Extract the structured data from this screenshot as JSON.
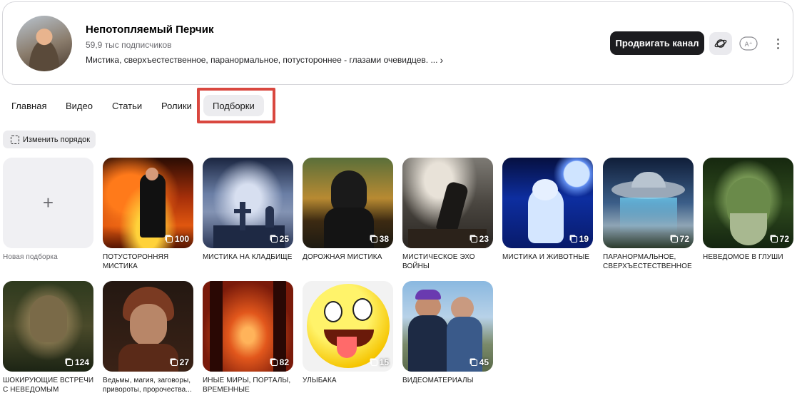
{
  "channel": {
    "title": "Непотопляемый Перчик",
    "subscribers": "59,9 тыс подписчиков",
    "description": "Мистика, сверхъестественное, паранормальное, потустороннее - глазами очевидцев. ...",
    "promote_label": "Продвигать канал",
    "ai_icon_text": "A⁺"
  },
  "tabs": [
    {
      "label": "Главная"
    },
    {
      "label": "Видео"
    },
    {
      "label": "Статьи"
    },
    {
      "label": "Ролики"
    },
    {
      "label": "Подборки"
    }
  ],
  "toolbar": {
    "reorder_label": "Изменить порядок"
  },
  "new_collection": {
    "label": "Новая подборка"
  },
  "collections": [
    {
      "title": "ПОТУСТОРОННЯЯ МИСТИКА",
      "count": "100"
    },
    {
      "title": "МИСТИКА НА КЛАДБИЩЕ",
      "count": "25"
    },
    {
      "title": "ДОРОЖНАЯ МИСТИКА",
      "count": "38"
    },
    {
      "title": "МИСТИЧЕСКОЕ ЭХО ВОЙНЫ",
      "count": "23"
    },
    {
      "title": "МИСТИКА И ЖИВОТНЫЕ",
      "count": "19"
    },
    {
      "title": "ПАРАНОРМАЛЬНОЕ, СВЕРХЪЕСТЕСТВЕННОЕ",
      "count": "72"
    },
    {
      "title": "НЕВЕДОМОЕ В ГЛУШИ",
      "count": "72"
    },
    {
      "title": "ШОКИРУЮЩИЕ ВСТРЕЧИ С НЕВЕДОМЫМ",
      "count": "124"
    },
    {
      "title": "Ведьмы, магия, заговоры, привороты, пророчества...",
      "count": "27"
    },
    {
      "title": "ИНЫЕ МИРЫ, ПОРТАЛЫ, ВРЕМЕННЫЕ ПЕТЛИ,СБО...",
      "count": "82"
    },
    {
      "title": "УЛЫБАКА",
      "count": "15"
    },
    {
      "title": "ВИДЕОМАТЕРИАЛЫ",
      "count": "45"
    }
  ],
  "colors": {
    "highlight": "#d9473f",
    "promote_bg": "#1c1c1f"
  }
}
